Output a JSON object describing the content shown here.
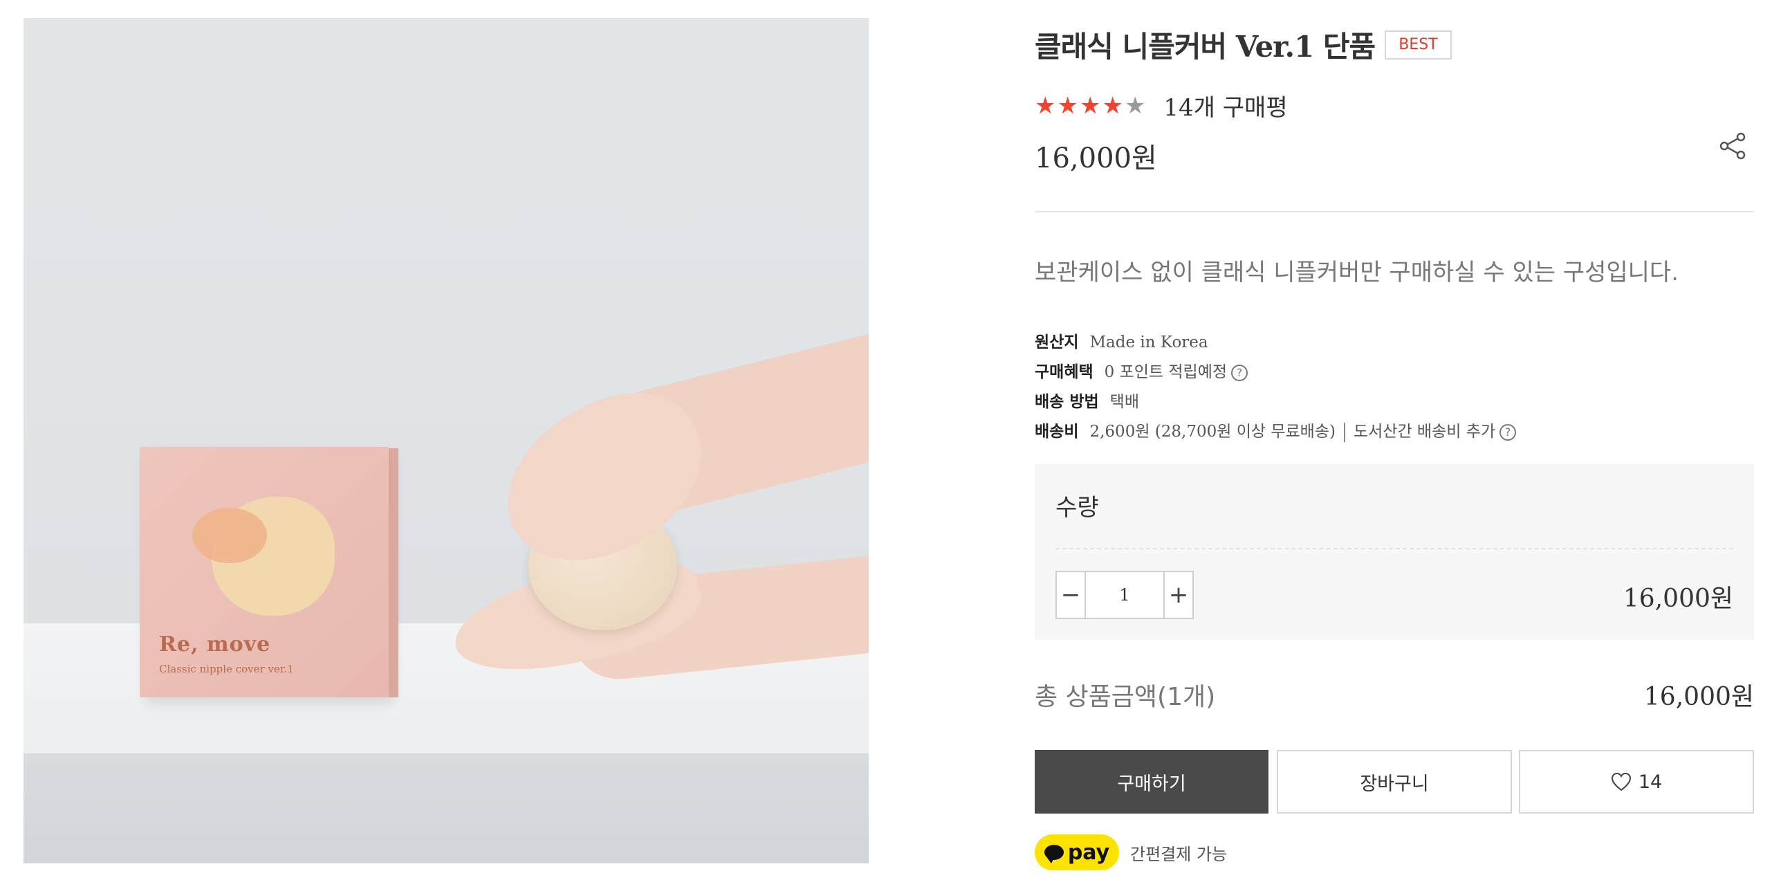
{
  "product_image": {
    "brand": "Re, move",
    "box_subtitle": "Classic nipple cover ver.1"
  },
  "product": {
    "title": "클래식 니플커버 Ver.1 단품",
    "badge": "BEST",
    "rating": 4,
    "rating_max": 5,
    "review_count": "14개 구매평",
    "price": "16,000원",
    "description": "보관케이스 없이 클래식 니플커버만 구매하실 수 있는 구성입니다."
  },
  "specs": {
    "origin_label": "원산지",
    "origin_value": "Made in Korea",
    "benefit_label": "구매혜택",
    "benefit_value": "0 포인트 적립예정",
    "shipping_method_label": "배송 방법",
    "shipping_method_value": "택배",
    "shipping_fee_label": "배송비",
    "shipping_fee_value": "2,600원 (28,700원 이상 무료배송)",
    "shipping_extra": "도서산간 배송비 추가",
    "help_glyph": "?"
  },
  "quantity": {
    "label": "수량",
    "value": "1",
    "minus": "−",
    "plus": "+",
    "line_price": "16,000원"
  },
  "total": {
    "label": "총 상품금액(1개)",
    "price": "16,000원"
  },
  "actions": {
    "buy_label": "구매하기",
    "cart_label": "장바구니",
    "like_count": "14"
  },
  "payment": {
    "brand": "pay",
    "text": "간편결제 가능"
  },
  "icons": {
    "share": "share-icon",
    "heart": "heart-icon",
    "star": "star-icon"
  },
  "colors": {
    "star_on": "#f0442e",
    "star_off": "#9a9a9a",
    "badge_text": "#e23b2e",
    "buy_button": "#4a4a4a",
    "kakao_yellow": "#ffe300"
  }
}
